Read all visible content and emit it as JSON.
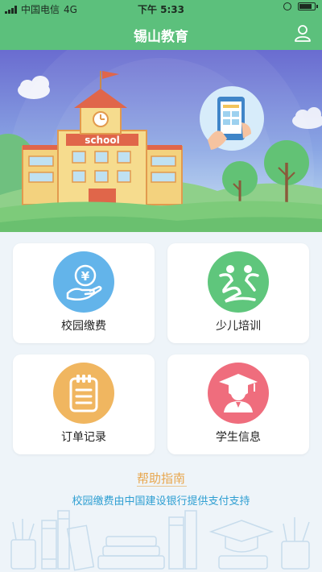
{
  "status_bar": {
    "carrier": "中国电信",
    "network": "4G",
    "time": "下午 5:33"
  },
  "nav": {
    "title": "锡山教育"
  },
  "banner": {
    "school_sign": "school"
  },
  "menu": [
    {
      "label": "校园缴费",
      "icon": "yen-hand-icon",
      "color": "#63b4ea"
    },
    {
      "label": "少儿培训",
      "icon": "kids-training-icon",
      "color": "#5fc67c"
    },
    {
      "label": "订单记录",
      "icon": "clipboard-icon",
      "color": "#f0b660"
    },
    {
      "label": "学生信息",
      "icon": "graduate-icon",
      "color": "#ef6d7d"
    }
  ],
  "help": {
    "title": "帮助指南",
    "support_text": "校园缴费由中国建设银行提供支付支持"
  },
  "colors": {
    "primary": "#5cc07c",
    "help": "#e8a64d",
    "link": "#2f9fd2"
  }
}
